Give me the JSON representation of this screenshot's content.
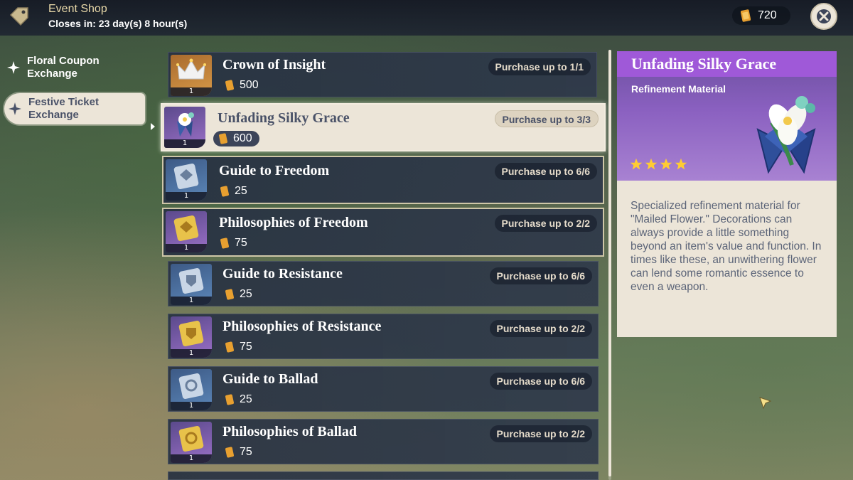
{
  "header": {
    "title": "Event Shop",
    "subtitle": "Closes in: 23 day(s) 8 hour(s)",
    "currency_icon": "festive-ticket-icon",
    "currency_amount": "720"
  },
  "nav": {
    "items": [
      {
        "label_line1": "Floral Coupon",
        "label_line2": "Exchange",
        "active": false
      },
      {
        "label_line1": "Festive Ticket",
        "label_line2": "Exchange",
        "active": true
      }
    ]
  },
  "items": [
    {
      "name": "Crown of Insight",
      "price": "500",
      "limit": "Purchase up to 1/1",
      "qty": "1",
      "icon": "crown-icon",
      "rarity_bg": "gold",
      "selected": false
    },
    {
      "name": "Unfading Silky Grace",
      "price": "600",
      "limit": "Purchase up to 3/3",
      "qty": "1",
      "icon": "silky-grace-icon",
      "rarity_bg": "purple",
      "selected": true
    },
    {
      "name": "Guide to Freedom",
      "price": "25",
      "limit": "Purchase up to 6/6",
      "qty": "1",
      "icon": "freedom-guide-icon",
      "rarity_bg": "blue",
      "selected": false
    },
    {
      "name": "Philosophies of Freedom",
      "price": "75",
      "limit": "Purchase up to 2/2",
      "qty": "1",
      "icon": "freedom-philosophies-icon",
      "rarity_bg": "purple",
      "selected": false
    },
    {
      "name": "Guide to Resistance",
      "price": "25",
      "limit": "Purchase up to 6/6",
      "qty": "1",
      "icon": "resistance-guide-icon",
      "rarity_bg": "blue",
      "selected": false
    },
    {
      "name": "Philosophies of Resistance",
      "price": "75",
      "limit": "Purchase up to 2/2",
      "qty": "1",
      "icon": "resistance-philosophies-icon",
      "rarity_bg": "purple",
      "selected": false
    },
    {
      "name": "Guide to Ballad",
      "price": "25",
      "limit": "Purchase up to 6/6",
      "qty": "1",
      "icon": "ballad-guide-icon",
      "rarity_bg": "blue",
      "selected": false
    },
    {
      "name": "Philosophies of Ballad",
      "price": "75",
      "limit": "Purchase up to 2/2",
      "qty": "1",
      "icon": "ballad-philosophies-icon",
      "rarity_bg": "purple",
      "selected": false
    }
  ],
  "detail": {
    "title": "Unfading Silky Grace",
    "type": "Refinement Material",
    "rarity_stars": 4,
    "description": "Specialized refinement material for \"Mailed Flower.\" Decorations can always provide a little something beyond an item's value and function. In times like these, an unwithering flower can lend some romantic essence to even a weapon."
  },
  "colors": {
    "accent_purple": "#9f59d8",
    "panel_cream": "#ece5d8",
    "row_dark": "#2e384a",
    "star_gold": "#ffcc33"
  }
}
